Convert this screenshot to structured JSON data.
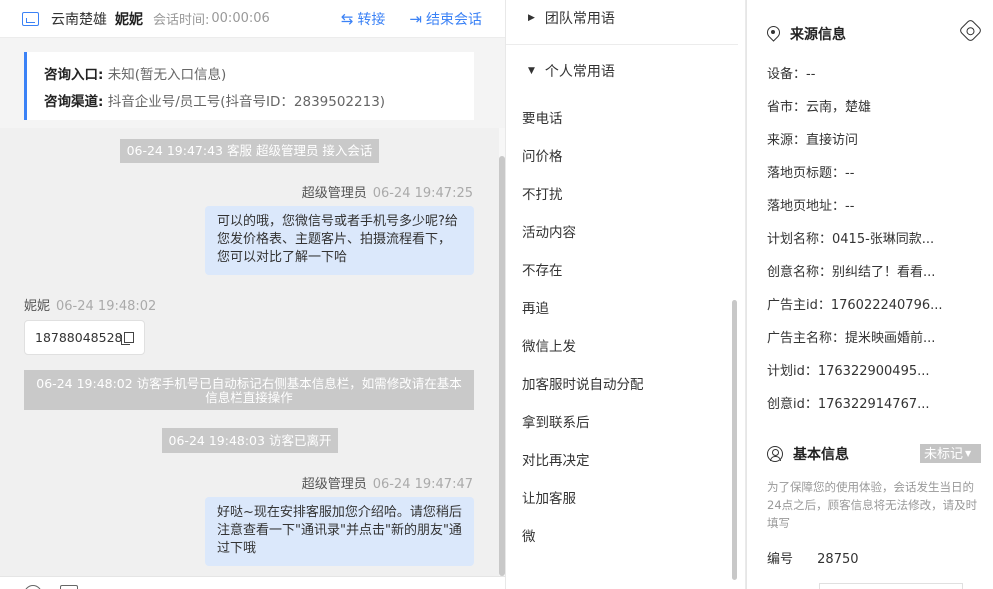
{
  "header": {
    "location": "云南楚雄",
    "customer_name": "妮妮",
    "session_time_label": "会话时间:",
    "session_time": "00:00:06",
    "transfer_label": "转接",
    "end_session_label": "结束会话"
  },
  "consult_info": {
    "entry_label": "咨询入口:",
    "entry_value": "未知(暂无入口信息)",
    "channel_label": "咨询渠道:",
    "channel_value": "抖音企业号/员工号(抖音号ID：2839502213)"
  },
  "messages": {
    "sys1": "06-24 19:47:43 客服 超级管理员 接入会话",
    "m1_sender": "超级管理员",
    "m1_time": "06-24 19:47:25",
    "m1_text": "可以的哦，您微信号或者手机号多少呢?给您发价格表、主题客片、拍摄流程看下，您可以对比了解一下哈",
    "m2_sender": "妮妮",
    "m2_time": "06-24 19:48:02",
    "m2_text": "18788048528",
    "sys2": "06-24 19:48:02 访客手机号已自动标记右侧基本信息栏，如需修改请在基本信息栏直接操作",
    "sys3": "06-24 19:48:03 访客已离开",
    "m3_sender": "超级管理员",
    "m3_time": "06-24 19:47:47",
    "m3_text": "好哒~现在安排客服加您介绍哈。请您稍后注意查看一下\"通讯录\"并点击\"新的朋友\"通过下哦"
  },
  "phrases": {
    "team_group": "团队常用语",
    "personal_group": "个人常用语",
    "items": [
      "要电话",
      "问价格",
      "不打扰",
      "活动内容",
      "不存在",
      "再追",
      "微信上发",
      "加客服时说自动分配",
      "拿到联系后",
      "对比再决定",
      "让加客服",
      "微"
    ]
  },
  "source_info": {
    "title": "来源信息",
    "device": "设备：--",
    "province_city": "省市：云南，楚雄",
    "source": "来源：直接访问",
    "landing_title": "落地页标题：--",
    "landing_url": "落地页地址：--",
    "plan_name": "计划名称：0415-张琳同款...",
    "creative_name": "创意名称：别纠结了！看看...",
    "advertiser_id": "广告主id：176022240796...",
    "advertiser_name": "广告主名称：提米映画婚前...",
    "plan_id": "计划id：176322900495...",
    "creative_id": "创意id：176322914767..."
  },
  "basic_info": {
    "title": "基本信息",
    "tag_label": "未标记",
    "note": "为了保障您的使用体验，会话发生当日的24点之后，顾客信息将无法修改，请及时填写",
    "number_label": "编号",
    "number_value": "28750"
  }
}
